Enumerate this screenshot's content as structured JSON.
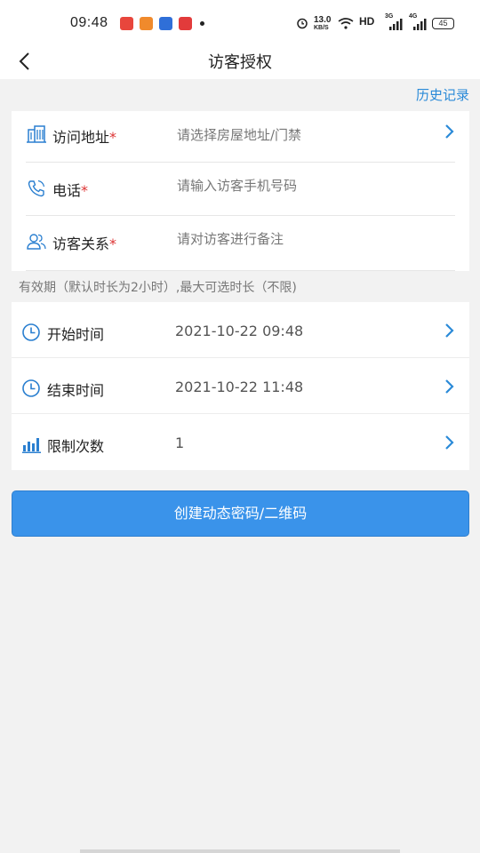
{
  "status_bar": {
    "time": "09:48",
    "net_speed_value": "13.0",
    "net_speed_unit": "KB/S",
    "hd_label": "HD",
    "signal1_label": "3G",
    "signal2_label": "4G",
    "battery": "45"
  },
  "header": {
    "title": "访客授权",
    "history_link": "历史记录"
  },
  "form": {
    "address": {
      "label": "访问地址",
      "required_mark": "*",
      "placeholder": "请选择房屋地址/门禁",
      "icon": "building-icon"
    },
    "phone": {
      "label": "电话",
      "required_mark": "*",
      "placeholder": "请输入访客手机号码",
      "icon": "phone-icon"
    },
    "relation": {
      "label": "访客关系",
      "required_mark": "*",
      "placeholder": "请对访客进行备注",
      "icon": "people-icon"
    }
  },
  "validity_note": "有效期（默认时长为2小时）,最大可选时长（不限)",
  "schedule": {
    "start": {
      "label": "开始时间",
      "value": "2021-10-22 09:48",
      "icon": "clock-icon"
    },
    "end": {
      "label": "结束时间",
      "value": "2021-10-22 11:48",
      "icon": "clock-icon"
    },
    "limit": {
      "label": "限制次数",
      "value": "1",
      "icon": "bar-chart-icon"
    }
  },
  "primary_button": "创建动态密码/二维码",
  "colors": {
    "accent": "#3a93ea",
    "link": "#2a8ad8",
    "required": "#dd3333",
    "icon": "#2a7fd0"
  }
}
